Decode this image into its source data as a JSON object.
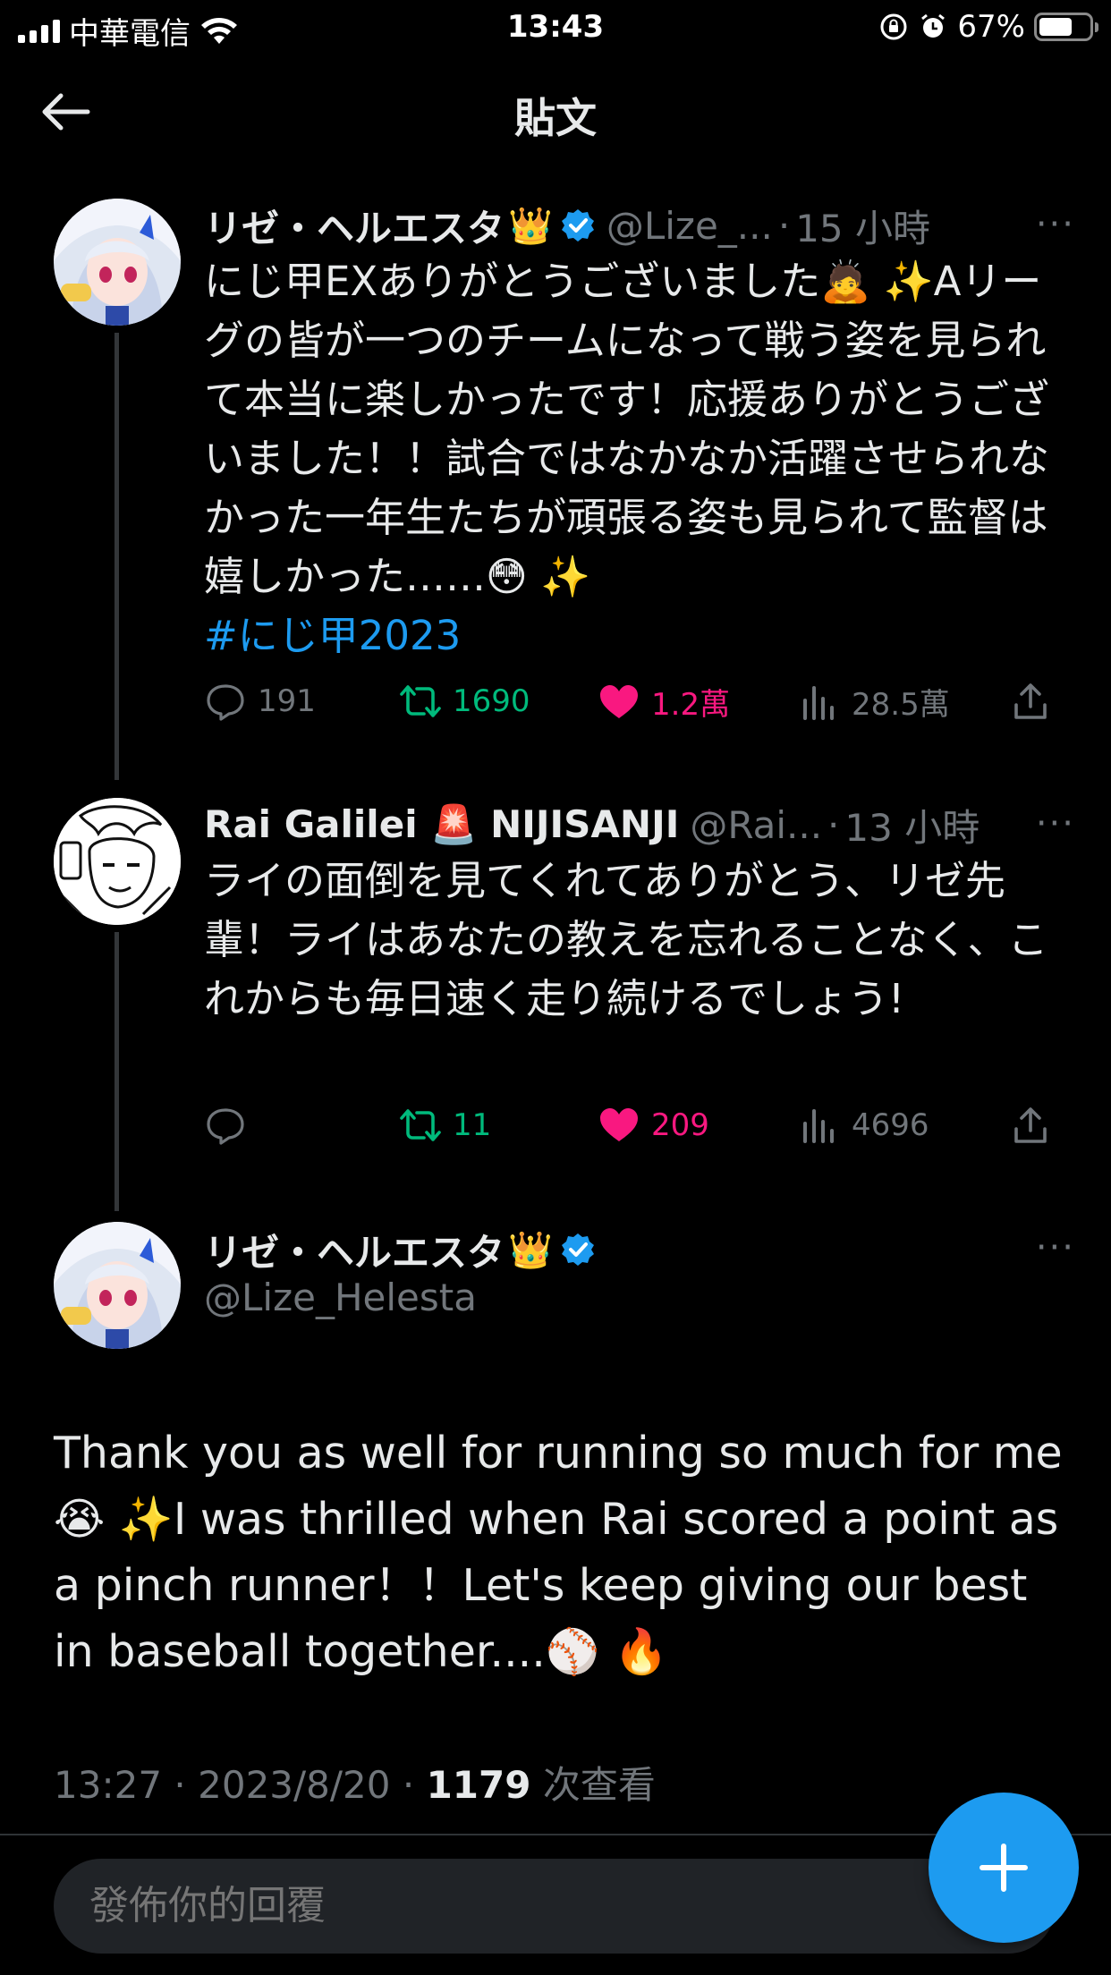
{
  "status_bar": {
    "carrier": "中華電信",
    "time": "13:43",
    "battery_percent": "67%"
  },
  "header": {
    "title": "貼文"
  },
  "thread": [
    {
      "display_name": "リゼ・ヘルエスタ",
      "name_emoji": "👑",
      "verified": true,
      "handle": "@Lize_...",
      "separator": "·",
      "time_ago": "15 小時",
      "more": "···",
      "text_main": "にじ甲EXありがとうございました🙇 ✨Aリーグの皆が一つのチームになって戦う姿を見られて本当に楽しかったです！応援ありがとうございました！！試合ではなかなか活躍させられなかった一年生たちが頑張る姿も見られて監督は嬉しかった……😳 ✨",
      "hashtag": "#にじ甲2023",
      "replies": "191",
      "retweets": "1690",
      "likes": "1.2萬",
      "views": "28.5萬"
    },
    {
      "display_name": "Rai Galilei 🚨 NIJISANJI",
      "handle": "@Rai...",
      "separator": "·",
      "time_ago": "13 小時",
      "more": "···",
      "text_main": "ライの面倒を見てくれてありがとう、リゼ先輩！ライはあなたの教えを忘れることなく、これからも毎日速く走り続けるでしょう!",
      "replies": "",
      "retweets": "11",
      "likes": "209",
      "views": "4696"
    }
  ],
  "main_tweet": {
    "display_name": "リゼ・ヘルエスタ",
    "name_emoji": "👑",
    "verified": true,
    "handle": "@Lize_Helesta",
    "more": "···",
    "text": "Thank you as well for running so much for me 😭 ✨I was thrilled when Rai scored a point as a pinch runner！！Let's keep giving our best in baseball together....⚾ 🔥",
    "time": "13:27",
    "sep1": "·",
    "date": "2023/8/20",
    "sep2": "·",
    "views_count": "1179",
    "views_label": "次查看"
  },
  "reply_bar": {
    "placeholder": "發佈你的回覆"
  },
  "colors": {
    "background": "#000000",
    "accent": "#1d9bf0",
    "retweet": "#00ba7c",
    "like": "#f91880",
    "muted": "#71767b"
  },
  "icons": {
    "back": "arrow-left-icon",
    "reply": "reply-bubble-icon",
    "retweet": "retweet-icon",
    "like": "heart-icon",
    "views": "bar-chart-icon",
    "share": "share-icon",
    "compose": "plus-icon",
    "verified": "verified-badge-icon"
  }
}
